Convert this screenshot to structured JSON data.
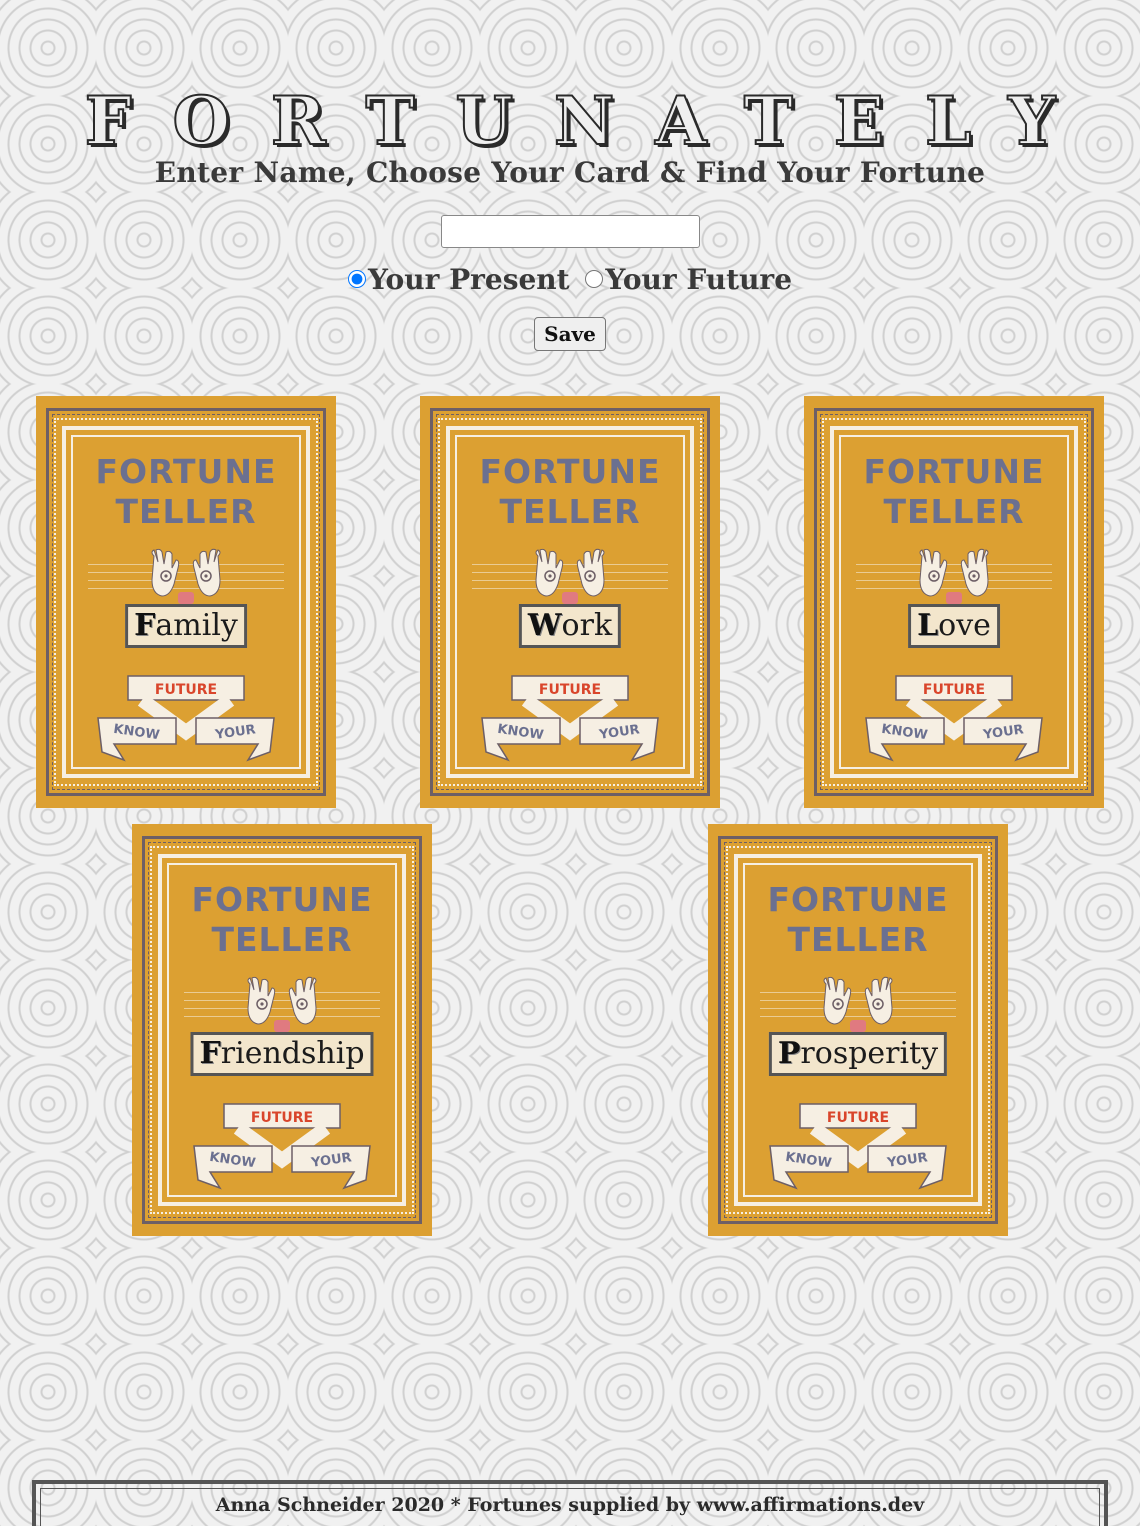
{
  "header": {
    "title": "FORTUNATELY",
    "subtitle": "Enter Name, Choose Your Card & Find Your Fortune"
  },
  "form": {
    "name_value": "",
    "name_placeholder": "",
    "options": [
      {
        "label": "Your Present",
        "checked": true
      },
      {
        "label": "Your Future",
        "checked": false
      }
    ],
    "save_label": "Save"
  },
  "cards": [
    {
      "heading_line1": "FORTUNE",
      "heading_line2": "TELLER",
      "initial": "F",
      "rest": "amily",
      "banner_top": "FUTURE",
      "banner_left": "KNOW",
      "banner_right": "YOUR"
    },
    {
      "heading_line1": "FORTUNE",
      "heading_line2": "TELLER",
      "initial": "W",
      "rest": "ork",
      "banner_top": "FUTURE",
      "banner_left": "KNOW",
      "banner_right": "YOUR"
    },
    {
      "heading_line1": "FORTUNE",
      "heading_line2": "TELLER",
      "initial": "L",
      "rest": "ove",
      "banner_top": "FUTURE",
      "banner_left": "KNOW",
      "banner_right": "YOUR"
    },
    {
      "heading_line1": "FORTUNE",
      "heading_line2": "TELLER",
      "initial": "F",
      "rest": "riendship",
      "banner_top": "FUTURE",
      "banner_left": "KNOW",
      "banner_right": "YOUR"
    },
    {
      "heading_line1": "FORTUNE",
      "heading_line2": "TELLER",
      "initial": "P",
      "rest": "rosperity",
      "banner_top": "FUTURE",
      "banner_left": "KNOW",
      "banner_right": "YOUR"
    }
  ],
  "footer": {
    "text": "Anna Schneider 2020 * Fortunes supplied by www.affirmations.dev"
  },
  "colors": {
    "card_background": "#dca032",
    "card_heading": "#6b7090",
    "banner_accent": "#d9452b"
  },
  "icons": [
    "palm-hands-icon",
    "ribbon-banner-icon"
  ]
}
